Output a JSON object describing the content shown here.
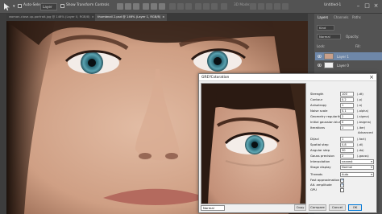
{
  "options_bar": {
    "auto_select_label": "Auto-Select:",
    "auto_select_value": "Layer",
    "transform_label": "Show Transform Controls",
    "mode_3d_label": "3D Mode:",
    "workspace_value": "Untitled-1"
  },
  "document_tabs": [
    {
      "label": "woman-close-up-portrait.jpg @ 146% (Layer 0, RGB/8)",
      "active": false
    },
    {
      "label": "thumbnail 2.psd @ 146% (Layer 1, RGB/8)",
      "active": true
    }
  ],
  "panels": {
    "tabs": [
      "Layers",
      "Channels",
      "Paths"
    ],
    "kind_label": "Kind",
    "blend_mode": "Normal",
    "opacity_label": "Opacity:",
    "lock_label": "Lock:",
    "fill_label": "Fill:",
    "layers": [
      {
        "name": "Layer 1",
        "active": true
      },
      {
        "name": "Layer 0",
        "active": false
      }
    ]
  },
  "dialog": {
    "title": "GREYCstoration",
    "params": [
      {
        "label": "Strength",
        "value": "100",
        "unit": "(-dt)"
      },
      {
        "label": "Contour",
        "value": "0.2",
        "unit": "(-p)"
      },
      {
        "label": "Anisotropy",
        "value": "1",
        "unit": "(-a)"
      },
      {
        "label": "Noise scale",
        "value": "0.1",
        "unit": "(-alpha)"
      },
      {
        "label": "Geometry regularity",
        "value": "2",
        "unit": "(-sigma)"
      },
      {
        "label": "Initial gaussian blur",
        "value": "0",
        "unit": "(-bsigma)"
      },
      {
        "label": "Iterations",
        "value": "1",
        "unit": "(-iter)"
      }
    ],
    "advanced_label": "Advanced",
    "adv_params": [
      {
        "label": "Dl/acl",
        "value": "1",
        "unit": "(-fact)"
      },
      {
        "label": "Spatial step",
        "value": "0.8",
        "unit": "(-dl)"
      },
      {
        "label": "Angular step",
        "value": "30",
        "unit": "(-da)"
      },
      {
        "label": "Gauss precision",
        "value": "2",
        "unit": "(-gauss)"
      }
    ],
    "interpolation_label": "Interpolation",
    "interpolation_value": "nearest",
    "stage_display_label": "Stage display",
    "stage_display_value": "Normal",
    "threads_label": "Threads",
    "threads_value": "Auto",
    "fast_approx_label": "Fast approximation",
    "alt_amplitude_label": "Alt. amplitude",
    "gpu_label": "GPU",
    "zoom_value": "Normal",
    "buttons": {
      "copy": "Copy",
      "compare": "Compare",
      "cancel": "Cancel",
      "ok": "OK"
    }
  },
  "colors": {
    "selection": "#6e87a8",
    "dialog_bg": "#f0f0f0",
    "ps_dark": "#535353"
  }
}
